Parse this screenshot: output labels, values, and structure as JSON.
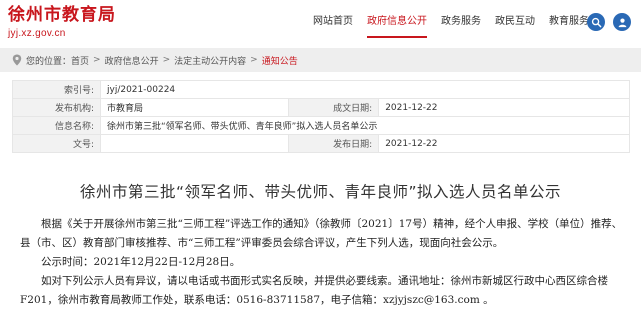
{
  "site": {
    "title": "徐州市教育局",
    "url": "jyj.xz.gov.cn",
    "brand_color": "#c8161d"
  },
  "nav": {
    "items": [
      {
        "label": "网站首页",
        "active": false
      },
      {
        "label": "政府信息公开",
        "active": true
      },
      {
        "label": "政务服务",
        "active": false
      },
      {
        "label": "政民互动",
        "active": false
      },
      {
        "label": "教育服务",
        "active": false
      }
    ],
    "search_icon": "search-icon",
    "user_icon": "user-icon"
  },
  "breadcrumb": {
    "prefix": "您的位置：",
    "items": [
      "首页",
      "政府信息公开",
      "法定主动公开内容",
      "通知公告"
    ]
  },
  "info": {
    "index_label": "索引号:",
    "index_value": "jyj/2021-00224",
    "publisher_label": "发布机构:",
    "publisher_value": "市教育局",
    "date_label": "成文日期:",
    "date_value": "2021-12-22",
    "name_label": "信息名称:",
    "name_value": "徐州市第三批“领军名师、带头优师、青年良师”拟入选人员名单公示",
    "doc_label": "文号:",
    "doc_value": "",
    "pubdate_label": "发布日期:",
    "pubdate_value": "2021-12-22"
  },
  "article": {
    "title": "徐州市第三批“领军名师、带头优师、青年良师”拟入选人员名单公示",
    "p1": "根据《关于开展徐州市第三批“三师工程”评选工作的通知》（徐教师〔2021〕17号）精神，经个人申报、学校（单位）推荐、县（市、区）教育部门审核推荐、市“三师工程”评审委员会综合评议，产生下列人选，现面向社会公示。",
    "p2": "公示时间：2021年12月22日-12月28日。",
    "p3": "如对下列公示人员有异议，请以电话或书面形式实名反映，并提供必要线索。通讯地址：徐州市新城区行政中心西区综合楼F201，徐州市教育局教师工作处，联系电话：0516-83711587，电子信箱：xzjyjszc@163.com 。"
  }
}
